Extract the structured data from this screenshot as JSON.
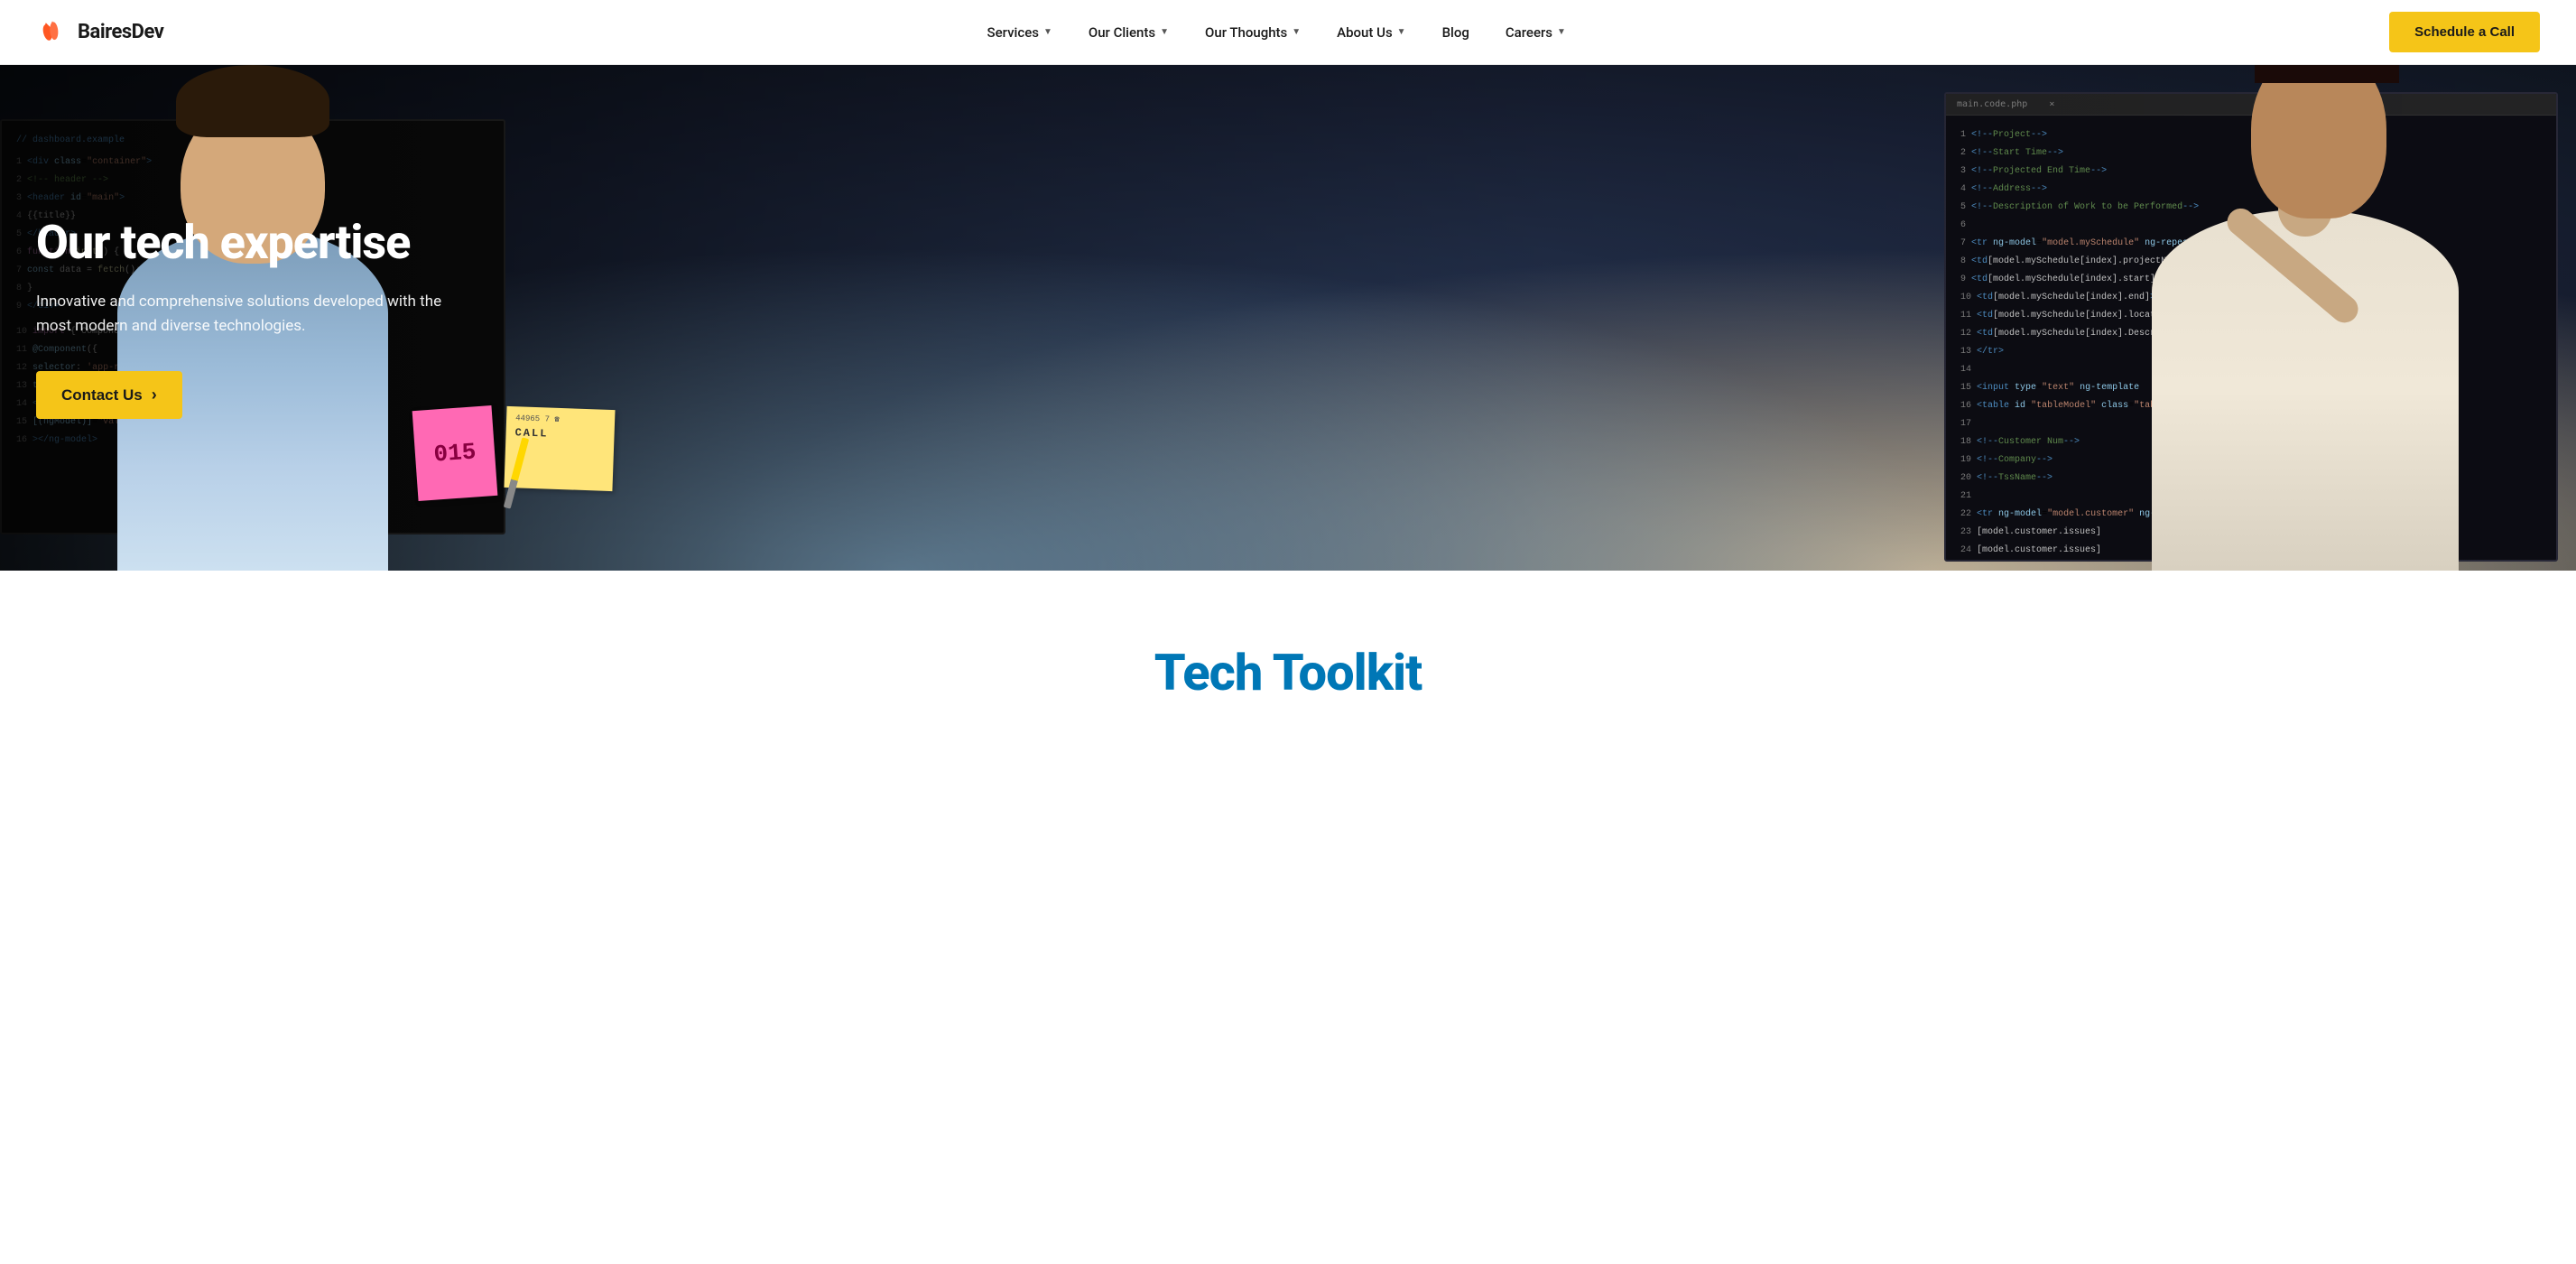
{
  "navbar": {
    "logo_text": "BairesDev",
    "nav_items": [
      {
        "label": "Services",
        "has_dropdown": true
      },
      {
        "label": "Our Clients",
        "has_dropdown": true
      },
      {
        "label": "Our Thoughts",
        "has_dropdown": true
      },
      {
        "label": "About Us",
        "has_dropdown": true
      },
      {
        "label": "Blog",
        "has_dropdown": false
      },
      {
        "label": "Careers",
        "has_dropdown": true
      }
    ],
    "cta_label": "Schedule a Call"
  },
  "hero": {
    "title": "Our tech expertise",
    "subtitle": "Innovative and comprehensive solutions developed with the most modern and diverse technologies.",
    "cta_label": "Contact Us",
    "cta_arrow": "›"
  },
  "tech_section": {
    "title": "Tech Toolkit"
  },
  "sticky": {
    "pink_text": "015",
    "yellow_line1": "44965 7 ☎",
    "yellow_line2": "CALL"
  },
  "colors": {
    "cta_bg": "#f5c518",
    "cta_text": "#1a1a1a",
    "logo_orange": "#FF5722",
    "hero_title": "#ffffff",
    "tech_title": "#0077b6"
  }
}
